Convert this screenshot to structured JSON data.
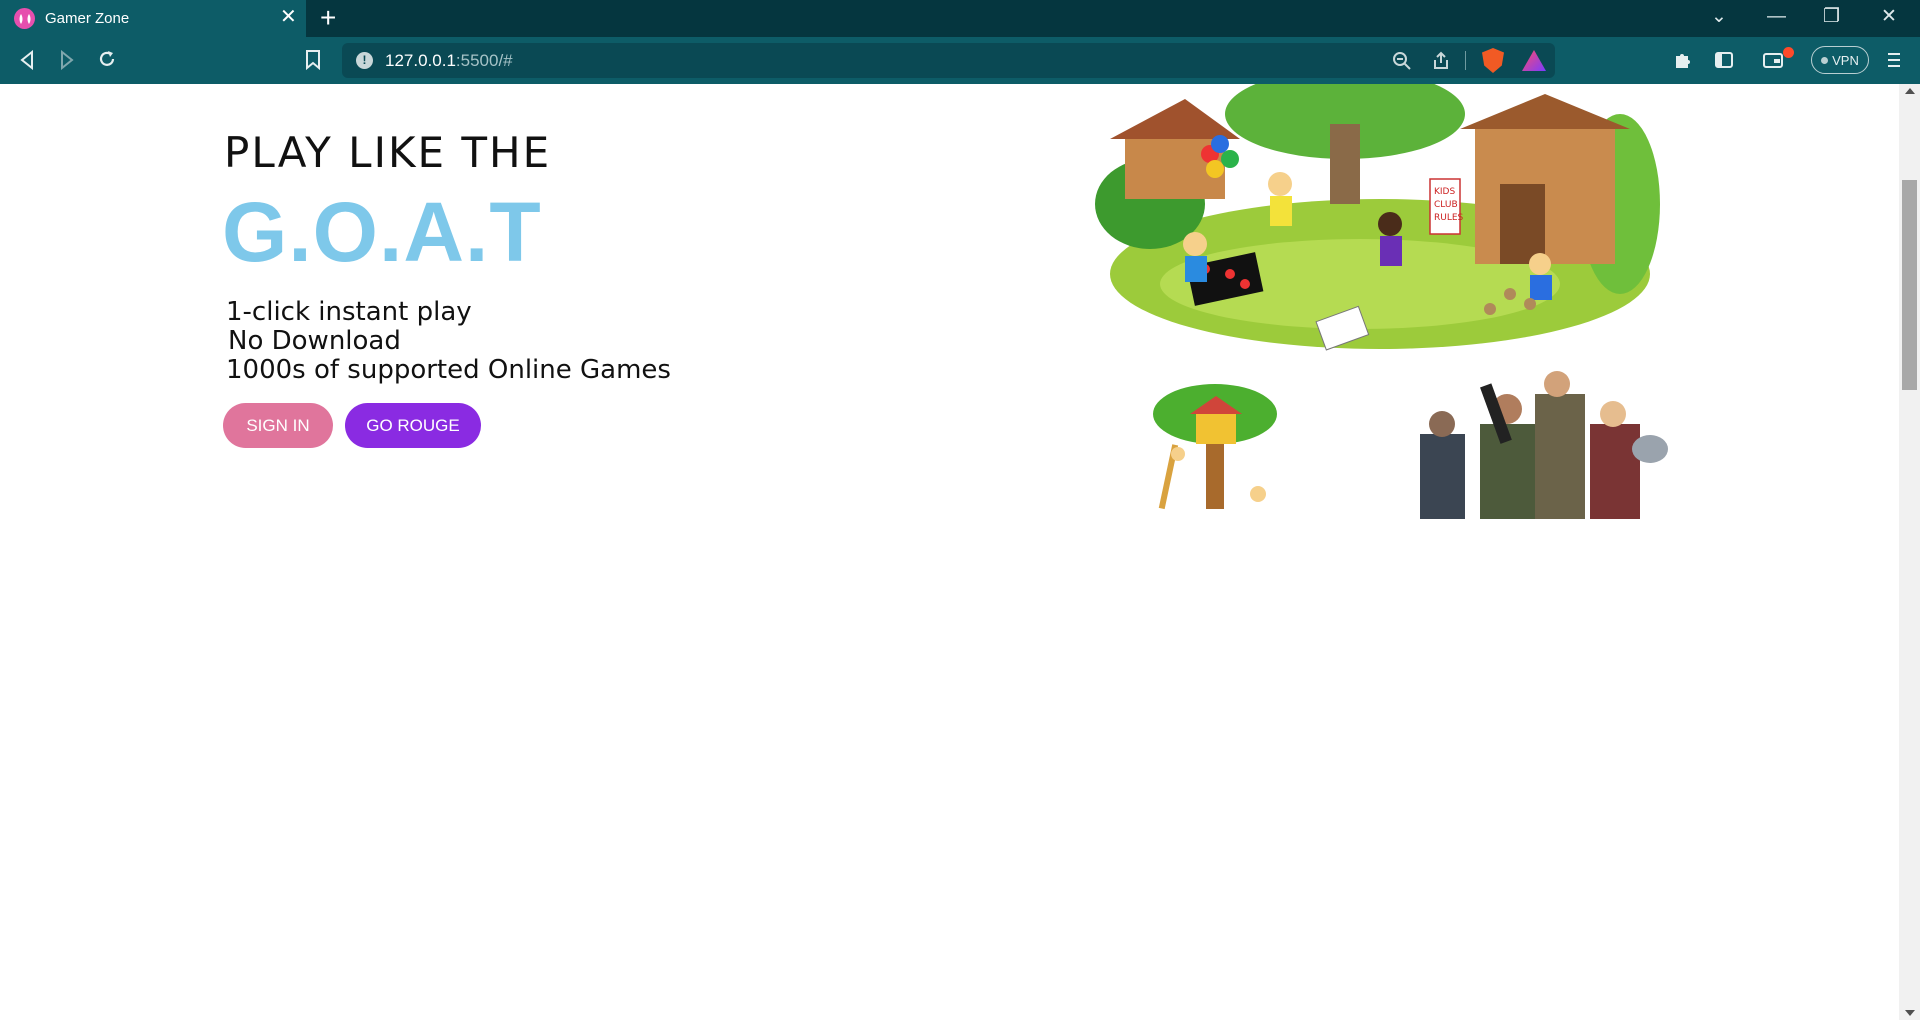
{
  "browser": {
    "tab_title": "Gamer Zone",
    "url_host": "127.0.0.1",
    "url_rest": ":5500/#",
    "vpn_label": "VPN"
  },
  "hero": {
    "headline": "PLAY LIKE THE",
    "highlight": "G.O.A.T",
    "features": [
      "1-click instant play",
      "No Download",
      "1000s of supported Online Games"
    ],
    "signin_label": "SIGN IN",
    "rouge_label": "GO ROUGE"
  },
  "colors": {
    "highlight": "#7ec8ea",
    "signin_button": "#e0759c",
    "rouge_button": "#8a2be2",
    "chrome": "#0d5c67"
  },
  "images": {
    "kids_club": "kids-club-illustration",
    "treehouse": "treehouse-illustration",
    "soldiers": "game-characters-illustration",
    "sign_text": [
      "KIDS",
      "CLUB",
      "RULES"
    ]
  }
}
